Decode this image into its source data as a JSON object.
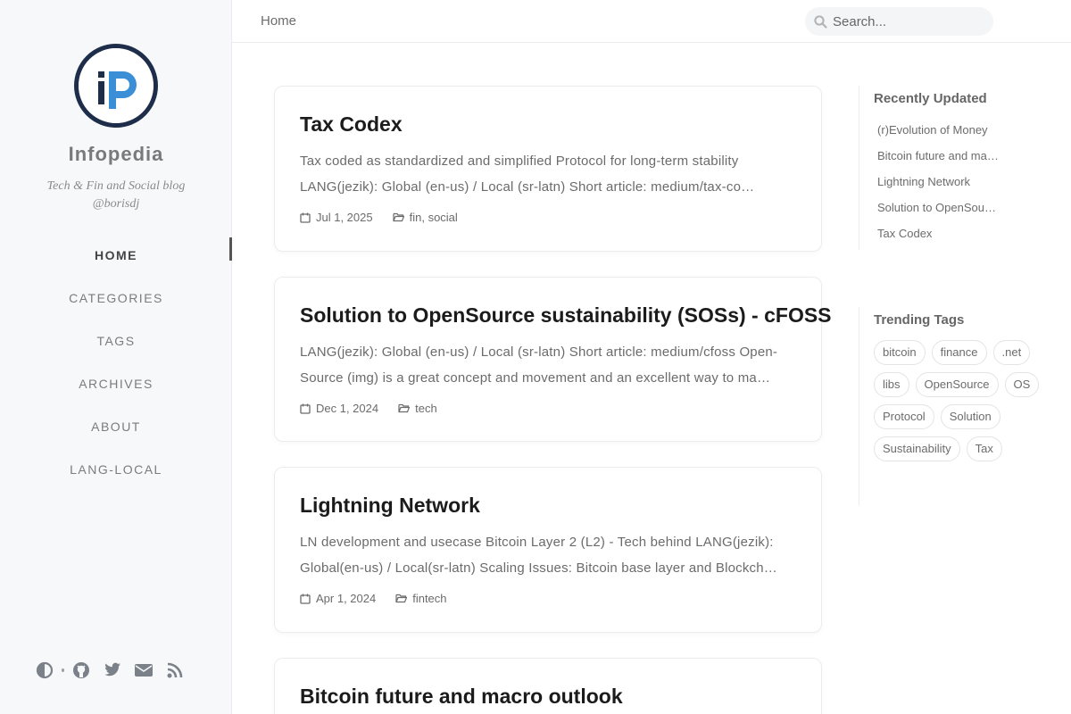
{
  "site": {
    "title": "Infopedia",
    "subtitle_line1": "Tech & Fin and Social blog",
    "subtitle_line2": "@borisdj"
  },
  "nav": {
    "items": [
      {
        "label": "HOME"
      },
      {
        "label": "CATEGORIES"
      },
      {
        "label": "TAGS"
      },
      {
        "label": "ARCHIVES"
      },
      {
        "label": "ABOUT"
      },
      {
        "label": "LANG-LOCAL"
      }
    ]
  },
  "sidebar_bottom": {
    "icons": [
      "theme-toggle-icon",
      "github-icon",
      "twitter-icon",
      "email-icon",
      "rss-icon"
    ]
  },
  "topbar": {
    "breadcrumb": "Home",
    "search_placeholder": "Search..."
  },
  "posts": [
    {
      "title": "Tax Codex",
      "excerpt_line1": "Tax coded as standardized and simplified Protocol for long-term stability",
      "excerpt_line2": "LANG(jezik): Global (en-us) / Local (sr-latn) Short article: medium/tax-co…",
      "date": "Jul 1, 2025",
      "categories": "fin, social"
    },
    {
      "title": "Solution to OpenSource sustainability (SOSs) - cFOSS",
      "excerpt_line1": "LANG(jezik): Global (en-us) / Local (sr-latn) Short article: medium/cfoss  Open-",
      "excerpt_line2": "Source (img) is a great concept and movement and an excellent way to ma…",
      "date": "Dec 1, 2024",
      "categories": "tech"
    },
    {
      "title": "Lightning Network",
      "excerpt_line1": "LN development and usecase Bitcoin Layer 2 (L2) - Tech behind LANG(jezik):",
      "excerpt_line2": "Global(en-us) / Local(sr-latn) Scaling Issues: Bitcoin base layer and Blockch…",
      "date": "Apr 1, 2024",
      "categories": "fintech"
    },
    {
      "title": "Bitcoin future and macro outlook"
    }
  ],
  "recently_updated": {
    "title": "Recently Updated",
    "items": [
      {
        "label": "(r)Evolution of Money"
      },
      {
        "label": "Bitcoin future and ma…"
      },
      {
        "label": "Lightning Network"
      },
      {
        "label": "Solution to OpenSou…"
      },
      {
        "label": "Tax Codex"
      }
    ]
  },
  "trending_tags": {
    "title": "Trending Tags",
    "items": [
      {
        "label": "bitcoin"
      },
      {
        "label": "finance"
      },
      {
        "label": ".net"
      },
      {
        "label": "libs"
      },
      {
        "label": "OpenSource"
      },
      {
        "label": "OS"
      },
      {
        "label": "Protocol"
      },
      {
        "label": "Solution"
      },
      {
        "label": "Sustainability"
      },
      {
        "label": "Tax"
      }
    ]
  },
  "colors": {
    "sidebar_bg": "#f6f8fa",
    "avatar_ring": "#1e2d4a",
    "avatar_accent": "#3a8fd6"
  }
}
